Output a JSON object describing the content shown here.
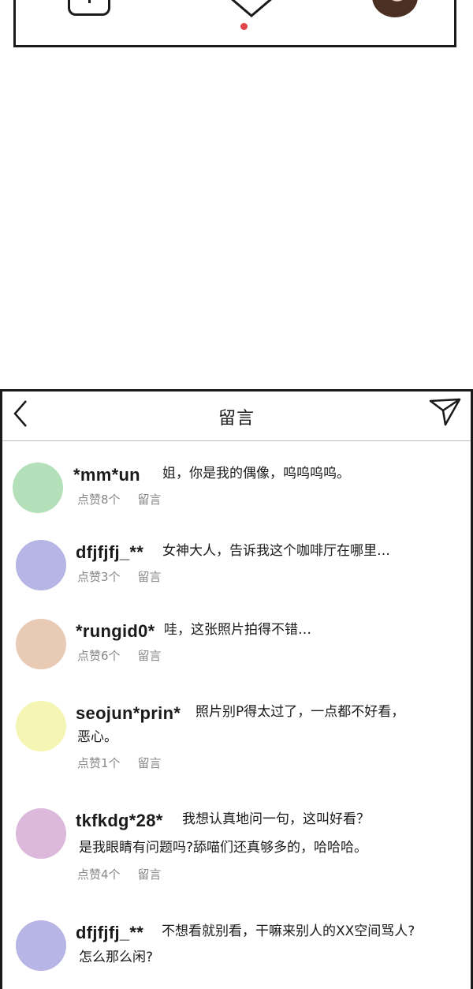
{
  "header": {
    "title": "留言"
  },
  "colors": {
    "like_dot": "#e0454a"
  },
  "comments": [
    {
      "username": "*mm*un",
      "lines": [
        "姐，你是我的偶像，呜呜呜呜。"
      ],
      "likes": "点赞8个",
      "reply": "留言",
      "avatar_color": "#b3e0b8"
    },
    {
      "username": "dfjfjfj_**",
      "lines": [
        "女神大人，告诉我这个咖啡厅在哪里…"
      ],
      "likes": "点赞3个",
      "reply": "留言",
      "avatar_color": "#b7b4e6"
    },
    {
      "username": "*rungid0*",
      "lines": [
        "哇，这张照片拍得不错…"
      ],
      "likes": "点赞6个",
      "reply": "留言",
      "avatar_color": "#e8cab5"
    },
    {
      "username": "seojun*prin*",
      "lines": [
        "照片别P得太过了，一点都不好看，",
        "恶心。"
      ],
      "likes": "点赞1个",
      "reply": "留言",
      "avatar_color": "#f6f6b4"
    },
    {
      "username": "tkfkdg*28*",
      "lines": [
        "我想认真地问一句，这叫好看？",
        "是我眼睛有问题吗?舔喵们还真够多的，哈哈哈。"
      ],
      "likes": "点赞4个",
      "reply": "留言",
      "avatar_color": "#dcb8dc"
    },
    {
      "username": "dfjfjfj_**",
      "lines": [
        "不想看就别看，干嘛来别人的XX空间骂人?",
        "怎么那么闲?"
      ],
      "likes": "",
      "reply": "",
      "avatar_color": "#b7b4e6"
    }
  ]
}
